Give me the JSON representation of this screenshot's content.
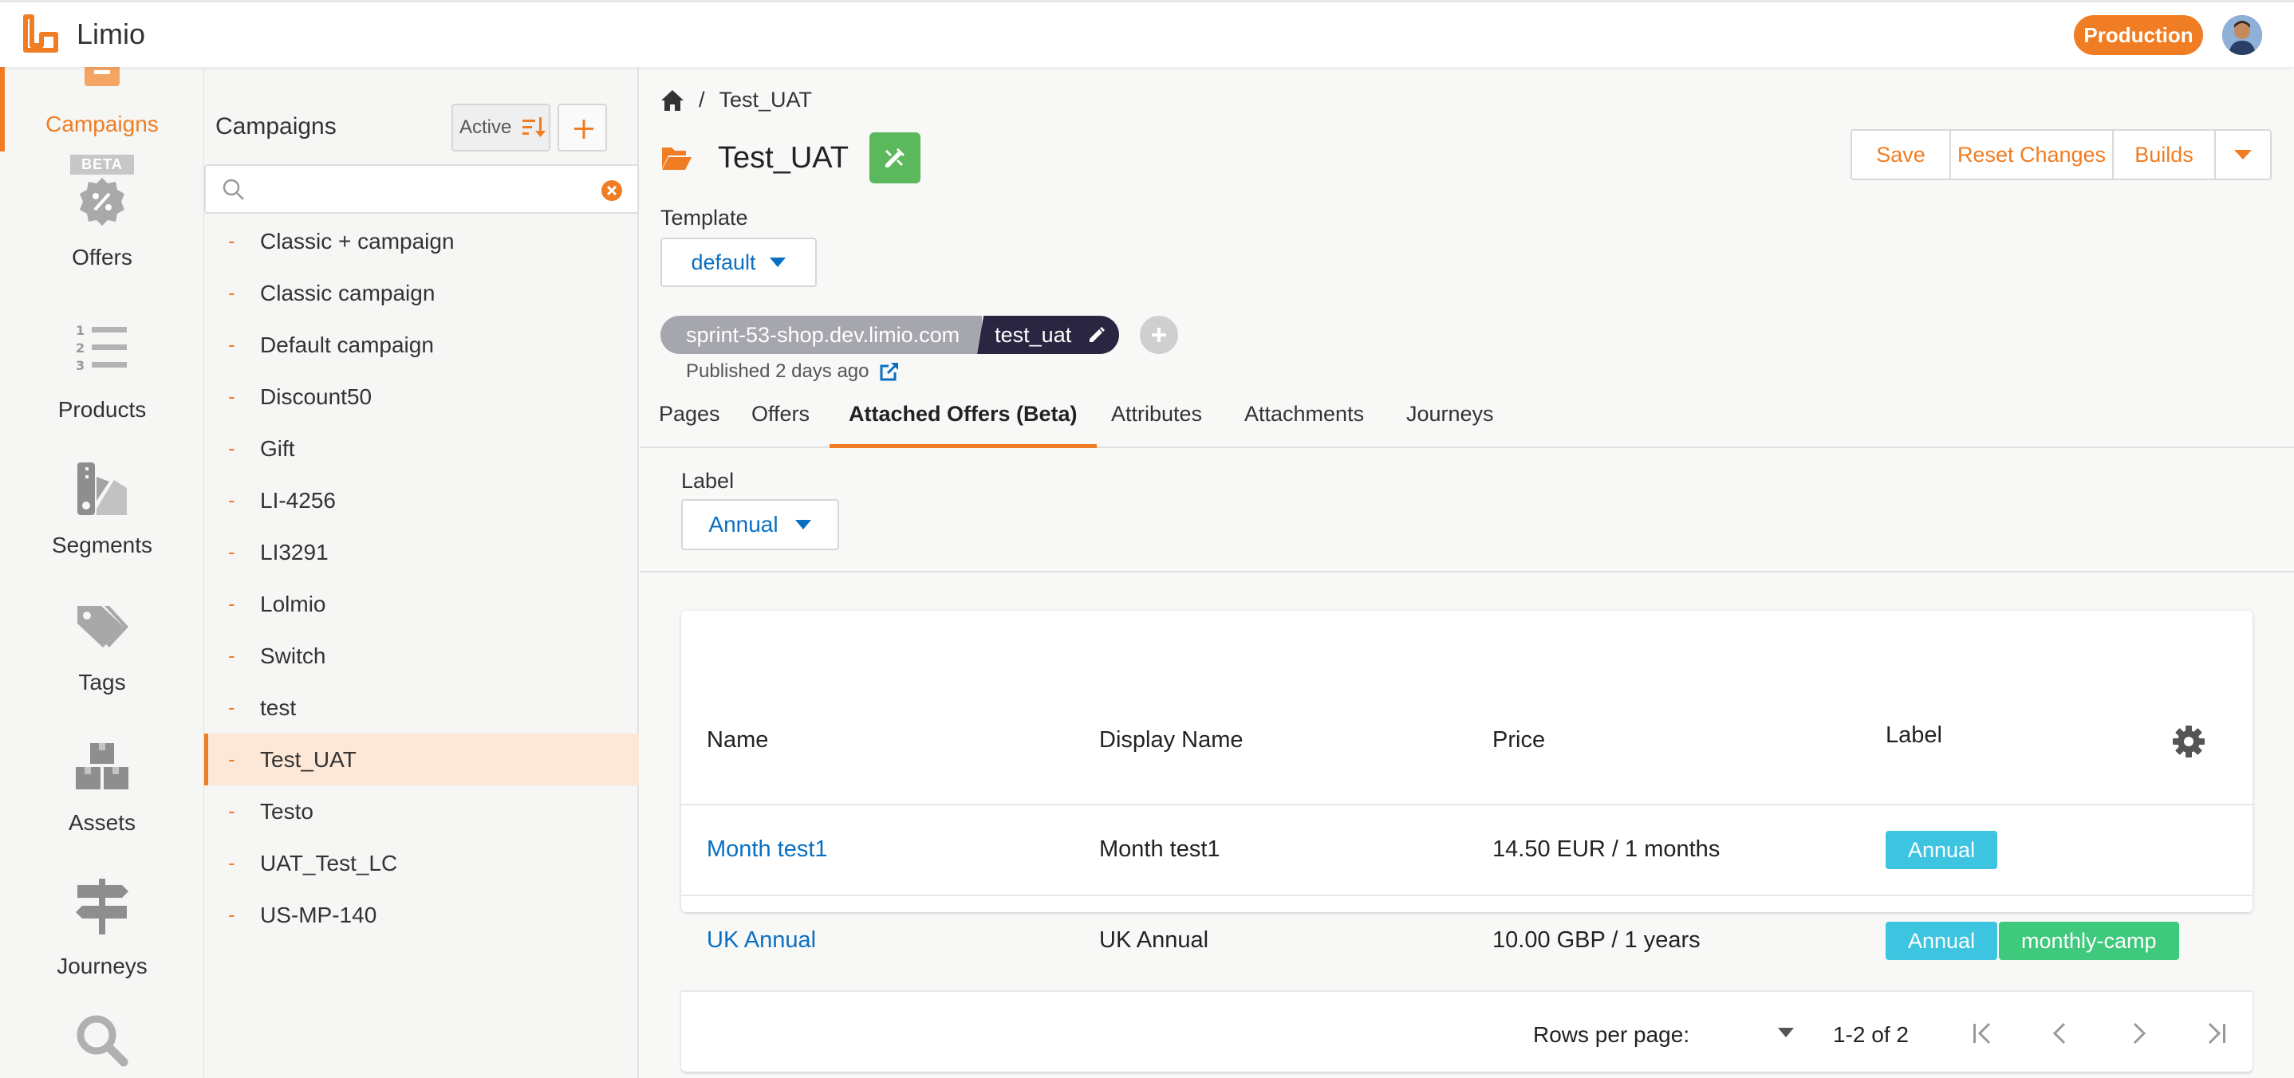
{
  "app": {
    "name": "Limio",
    "environment": "Production"
  },
  "nav": {
    "items": [
      {
        "label": "Campaigns"
      },
      {
        "label": "Offers",
        "badge": "BETA"
      },
      {
        "label": "Products"
      },
      {
        "label": "Segments"
      },
      {
        "label": "Tags"
      },
      {
        "label": "Assets"
      },
      {
        "label": "Journeys"
      }
    ]
  },
  "list": {
    "title": "Campaigns",
    "filter_label": "Active",
    "search_placeholder": "",
    "items": [
      {
        "label": "Classic + campaign"
      },
      {
        "label": "Classic campaign"
      },
      {
        "label": "Default campaign"
      },
      {
        "label": "Discount50"
      },
      {
        "label": "Gift"
      },
      {
        "label": "LI-4256"
      },
      {
        "label": "LI3291"
      },
      {
        "label": "Lolmio"
      },
      {
        "label": "Switch"
      },
      {
        "label": "test"
      },
      {
        "label": "Test_UAT"
      },
      {
        "label": "Testo"
      },
      {
        "label": "UAT_Test_LC"
      },
      {
        "label": "US-MP-140"
      }
    ],
    "selected": "Test_UAT"
  },
  "main": {
    "breadcrumb": {
      "sep": "/",
      "current": "Test_UAT"
    },
    "title": "Test_UAT",
    "actions": {
      "save": "Save",
      "reset": "Reset Changes",
      "builds": "Builds"
    },
    "template": {
      "label": "Template",
      "value": "default"
    },
    "url": {
      "domain": "sprint-53-shop.dev.limio.com",
      "slug": "test_uat"
    },
    "published": "Published 2 days ago",
    "tabs": [
      {
        "label": "Pages"
      },
      {
        "label": "Offers"
      },
      {
        "label": "Attached Offers (Beta)"
      },
      {
        "label": "Attributes"
      },
      {
        "label": "Attachments"
      },
      {
        "label": "Journeys"
      }
    ],
    "label_filter": {
      "label": "Label",
      "value": "Annual"
    },
    "table": {
      "headers": {
        "name": "Name",
        "display_name": "Display Name",
        "price": "Price",
        "label": "Label"
      },
      "rows": [
        {
          "name": "Month test1",
          "display_name": "Month test1",
          "price": "14.50 EUR / 1 months",
          "labels": [
            "Annual"
          ]
        },
        {
          "name": "UK Annual",
          "display_name": "UK Annual",
          "price": "10.00 GBP / 1 years",
          "labels": [
            "Annual",
            "monthly-camp"
          ]
        }
      ],
      "footer": {
        "rows_per_page_label": "Rows per page:",
        "rows_per_page_value": "",
        "range": "1-2 of 2"
      }
    }
  },
  "colors": {
    "accent": "#f07d23",
    "link": "#0a6fc2",
    "chip_blue": "#3cc4e0",
    "chip_green": "#3ec97c",
    "dark": "#2a2540"
  }
}
